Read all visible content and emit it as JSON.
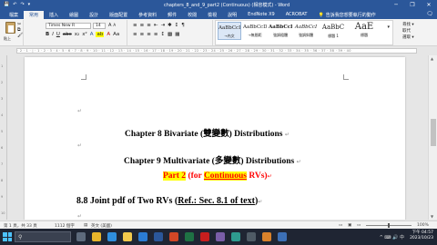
{
  "window": {
    "title": "chapters_8_and_9_part2 (Continuous) (相容模式) - Word",
    "user": "",
    "quick_access": [
      "💾",
      "↶",
      "↷",
      "▾"
    ],
    "controls": [
      "─",
      "❐",
      "✕"
    ]
  },
  "ribbon_tabs": {
    "items": [
      "檔案",
      "常用",
      "插入",
      "繪圖",
      "設計",
      "版面配置",
      "參考資料",
      "郵件",
      "校閱",
      "檢視",
      "說明",
      "EndNote X9",
      "ACROBAT"
    ],
    "active_index": 1,
    "tell_me": "告訴我您想要執行的動作",
    "share": "🗨"
  },
  "clipboard": {
    "paste_label": "貼上",
    "cut": "✂",
    "copy": "⧉",
    "format_painter": "🖌"
  },
  "font": {
    "name": "Times New R",
    "size": "14",
    "format_buttons": [
      "B",
      "I",
      "U",
      "abc",
      "x₂",
      "x²",
      "A",
      "ab",
      "A",
      "Aa"
    ],
    "grow": "A",
    "shrink": "A"
  },
  "paragraph": {
    "row1": [
      "≡",
      "≡",
      "≡",
      "⇤",
      "⇥",
      "✱",
      "↕",
      "¶"
    ],
    "row2": [
      "≡",
      "≡",
      "≡",
      "≡",
      "↕",
      "▩",
      "▦"
    ]
  },
  "styles": {
    "items": [
      {
        "sample": "AaBbCcI",
        "name": "→內文"
      },
      {
        "sample": "AaBbCcD",
        "name": "→無間距"
      },
      {
        "sample": "AaBbCcI",
        "name": "強調粗體"
      },
      {
        "sample": "AaBbCcI",
        "name": "強調斜體"
      },
      {
        "sample": "AaBbC",
        "name": "標題 1"
      },
      {
        "sample": "AaE",
        "name": "標題"
      }
    ],
    "selected_index": 0
  },
  "editing": {
    "find": "尋找 ▾",
    "replace": "取代",
    "select": "選取 ▾"
  },
  "ruler": {
    "scale": "· 2 · 1 · | · 1 · 2 · 3 · 4 · 5 · 6 · 7 · 8 · 9 · 10 · 11 · 12 · 13 · 14 · 15 · 16 · 17 · 18 · 19 · 20 · 21 · 22 · 23 · 24 · 25 · 26 · 27 · 28 · 29 · 30 · 31 · 32 · 33 · 34 · 35 · 36 · 37 · 38 · 39 · 40",
    "vertical_ticks": [
      "1",
      "2",
      "3",
      "4",
      "5",
      "6",
      "7",
      "8",
      "9",
      "10"
    ]
  },
  "document": {
    "line1": {
      "text": "Chapter 8 Bivariate (雙變數) Distributions",
      "mark": "↵"
    },
    "line2": {
      "text": "Chapter 9 Multivariate (多變數) Distributions",
      "mark": "↵"
    },
    "line3": {
      "part": "Part 2",
      "open": " (for ",
      "continuous": "Continuous",
      "close": " RVs)",
      "mark": "↵"
    },
    "line4": {
      "prefix": "8.8 Joint pdf of Two RVs (",
      "ref": "Ref.: Sec. 8.1 of text",
      "suffix": ")",
      "mark": "↵"
    },
    "empty_marks": [
      "↵",
      "↵",
      "↵"
    ]
  },
  "status": {
    "page": "第 1 頁，共 33 頁",
    "words": "1112 個字",
    "language": "英文 (美國)",
    "zoom": "100%"
  },
  "taskbar": {
    "search_icon": "⚲",
    "apps": [
      {
        "name": "task-view",
        "color": "#5e6b7d"
      },
      {
        "name": "chrome",
        "color": "#e8b52b"
      },
      {
        "name": "edge",
        "color": "#2f8fde"
      },
      {
        "name": "file-explorer",
        "color": "#f2c94c"
      },
      {
        "name": "mail",
        "color": "#2b7cd3"
      },
      {
        "name": "word",
        "color": "#2b579a"
      },
      {
        "name": "powerpoint",
        "color": "#d24726"
      },
      {
        "name": "excel",
        "color": "#1f7244"
      },
      {
        "name": "acrobat",
        "color": "#c81e1e"
      },
      {
        "name": "app10",
        "color": "#7a5ea8"
      },
      {
        "name": "app11",
        "color": "#2e9b8f"
      },
      {
        "name": "app12",
        "color": "#4f5b66"
      },
      {
        "name": "app13",
        "color": "#d9822b"
      },
      {
        "name": "app14",
        "color": "#3c6fb5"
      }
    ],
    "tray_icons": "^ ⌨ 🔊 中",
    "time": "下午 04:57",
    "date": "2023/10/23"
  }
}
